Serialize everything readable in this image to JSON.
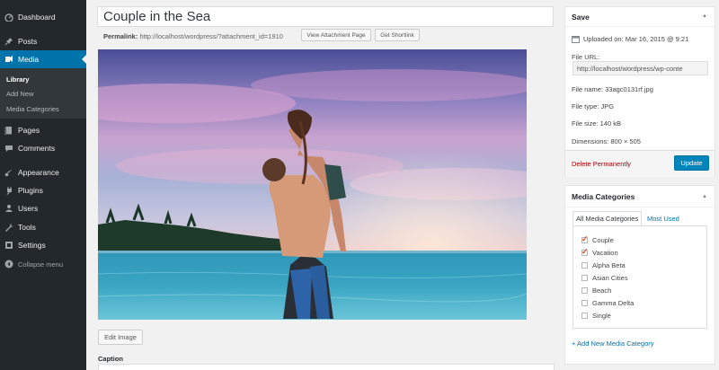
{
  "sidebar": {
    "items": [
      {
        "label": "Dashboard",
        "icon": "dashboard-icon"
      },
      {
        "label": "Posts",
        "icon": "pin-icon"
      },
      {
        "label": "Media",
        "icon": "media-icon"
      },
      {
        "label": "Pages",
        "icon": "pages-icon"
      },
      {
        "label": "Comments",
        "icon": "comments-icon"
      },
      {
        "label": "Appearance",
        "icon": "brush-icon"
      },
      {
        "label": "Plugins",
        "icon": "plug-icon"
      },
      {
        "label": "Users",
        "icon": "users-icon"
      },
      {
        "label": "Tools",
        "icon": "wrench-icon"
      },
      {
        "label": "Settings",
        "icon": "settings-icon"
      }
    ],
    "submenu": [
      "Library",
      "Add New",
      "Media Categories"
    ],
    "collapse_label": "Collapse menu",
    "active_color": "#0073aa"
  },
  "editor": {
    "title": "Couple in the Sea",
    "permalink_label": "Permalink:",
    "permalink_url": "http://localhost/wordpress/?attachment_id=1910",
    "view_attachment_label": "View Attachment Page",
    "get_shortlink_label": "Get Shortlink",
    "edit_image_label": "Edit Image",
    "caption_label": "Caption"
  },
  "save_panel": {
    "title": "Save",
    "uploaded_on": "Uploaded on: Mar 16, 2015 @ 9:21",
    "file_url_label": "File URL:",
    "file_url": "http://localhost/wordpress/wp-conte",
    "file_name": "File name: 33agc0131rf.jpg",
    "file_type": "File type: JPG",
    "file_size": "File size: 140 kB",
    "dimensions": "Dimensions: 800 × 505",
    "delete_label": "Delete Permanently",
    "update_label": "Update"
  },
  "categories_panel": {
    "title": "Media Categories",
    "tabs": [
      "All Media Categories",
      "Most Used"
    ],
    "items": [
      {
        "label": "Couple",
        "checked": true
      },
      {
        "label": "Vacation",
        "checked": true
      },
      {
        "label": "Alpha Beta",
        "checked": false
      },
      {
        "label": "Asian Cities",
        "checked": false
      },
      {
        "label": "Beach",
        "checked": false
      },
      {
        "label": "Gamma Delta",
        "checked": false
      },
      {
        "label": "Single",
        "checked": false
      }
    ],
    "add_new_label": "+ Add New Media Category"
  }
}
